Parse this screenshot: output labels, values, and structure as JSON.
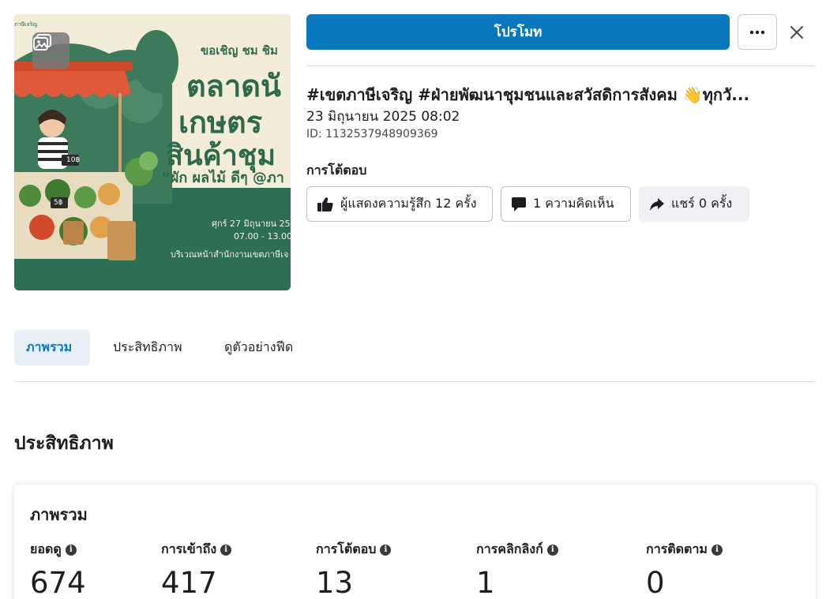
{
  "header": {
    "promote_label": "โปรโมท",
    "more_icon": "ellipsis-icon",
    "close_icon": "close-icon"
  },
  "thumbnail": {
    "logo_text": "ภาษีเจริญ",
    "invite_text": "ขอเชิญ ชม ชิม",
    "headline_1": "ตลาดนั",
    "headline_2": "เกษตร",
    "headline_3": "สินค้าชุม",
    "quote_text": "“ผัก ผลไม้ ดีๆ @ภา",
    "date_text": "ศุกร์ 27 มิถุนายน 25",
    "time_text": "07.00 - 13.00",
    "place_text": "บริเวณหน้าสำนักงานเขตภาษีเจ",
    "price_tag_1": "10฿",
    "price_tag_2": "5฿",
    "gallery_icon": "gallery-icon",
    "colors": {
      "background": "#2e6e54",
      "cream": "#f3ecd9"
    }
  },
  "post": {
    "title": "#เขตภาษีเจริญ #ฝ่ายพัฒนาชุมชนและสวัสดิการสังคม 👋ทุกวั...",
    "date": "23 มิถุนายน 2025 08:02",
    "id_label": "ID: 1132537948909369"
  },
  "engagement": {
    "label": "การโต้ตอบ",
    "reactions": "ผู้แสดงความรู้สึก 12 ครั้ง",
    "comments": "1 ความคิดเห็น",
    "shares": "แชร์ 0 ครั้ง"
  },
  "tabs": [
    {
      "label": "ภาพรวม",
      "active": true
    },
    {
      "label": "ประสิทธิภาพ",
      "active": false
    },
    {
      "label": "ดูตัวอย่างฟีด",
      "active": false
    }
  ],
  "performance": {
    "section_title": "ประสิทธิภาพ",
    "card_title": "ภาพรวม",
    "metrics": [
      {
        "label": "ยอดดู",
        "value": "674"
      },
      {
        "label": "การเข้าถึง",
        "value": "417"
      },
      {
        "label": "การโต้ตอบ",
        "value": "13"
      },
      {
        "label": "การคลิกลิงก์",
        "value": "1"
      },
      {
        "label": "การติดตาม",
        "value": "0"
      }
    ]
  },
  "colors": {
    "accent": "#0a78be",
    "tab_active_bg": "#e7f0f9",
    "divider": "#dadde1"
  }
}
